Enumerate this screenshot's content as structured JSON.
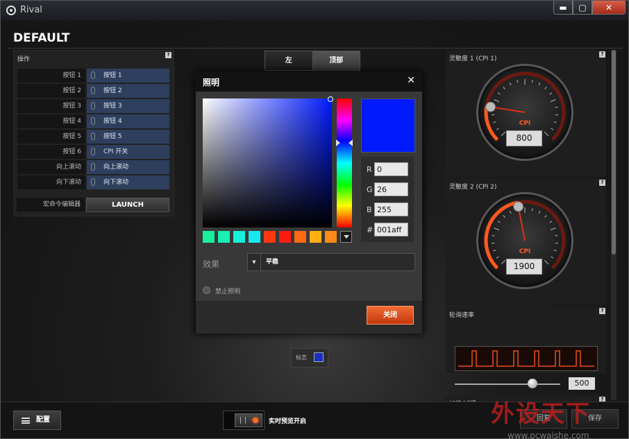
{
  "window": {
    "title": "Rival",
    "minimize": "▬",
    "maximize": "▢",
    "close": "✕"
  },
  "page_title": "DEFAULT",
  "actions": {
    "label": "操作",
    "help": "?",
    "rows": [
      {
        "key": "按钮 1",
        "value": "按钮 1"
      },
      {
        "key": "按钮 2",
        "value": "按钮 2"
      },
      {
        "key": "按钮 3",
        "value": "按钮 3"
      },
      {
        "key": "按钮 4",
        "value": "按钮 4"
      },
      {
        "key": "按钮 5",
        "value": "按钮 5"
      },
      {
        "key": "按钮 6",
        "value": "CPI 开关"
      },
      {
        "key": "向上滚动",
        "value": "向上滚动"
      },
      {
        "key": "向下滚动",
        "value": "向下滚动"
      }
    ],
    "macro_label": "宏命令编辑器",
    "macro_button": "LAUNCH"
  },
  "tabs": [
    "左",
    "顶部"
  ],
  "dialog": {
    "title": "照明",
    "close": "✕",
    "color_hex_value": "#001aff",
    "rgb": [
      {
        "label": "R",
        "value": "0"
      },
      {
        "label": "G",
        "value": "26"
      },
      {
        "label": "B",
        "value": "255"
      },
      {
        "label": "#",
        "value": "001aff"
      }
    ],
    "swatches": [
      "#18f0a0",
      "#18f0b4",
      "#18f0d8",
      "#18e8f0",
      "#ff3810",
      "#ff1a10",
      "#ff6a10",
      "#ffb010",
      "#ff8a18"
    ],
    "effect_label": "效果",
    "effect_value": "平稳",
    "effect_arrow": "▼",
    "disable_label": "禁止照明",
    "close_button": "关闭"
  },
  "logo_zone": {
    "label": "标志",
    "color": "#1a2fbf"
  },
  "sensitivity1": {
    "label": "灵敏度 1 (CPI 1)",
    "help": "?",
    "cpi_label": "CPI",
    "value": "800",
    "fraction": 0.2
  },
  "sensitivity2": {
    "label": "灵敏度 2 (CPI 2)",
    "help": "?",
    "cpi_label": "CPI",
    "value": "1900",
    "fraction": 0.46
  },
  "polling": {
    "label": "轮询速率",
    "help": "?",
    "value": "500"
  },
  "accel": {
    "label": "加快/减慢",
    "help": "?"
  },
  "bottom": {
    "config_button": "配置",
    "live_preview": "实时预览开启",
    "reset_button": "回复",
    "save_button": "保存"
  },
  "watermark": {
    "main": "外设天下",
    "url": "www.pcwaishe.com"
  },
  "colors": {
    "accent": "#e8501e",
    "selected_blue": "#001aff",
    "action_blue": "#2e3f5e"
  }
}
